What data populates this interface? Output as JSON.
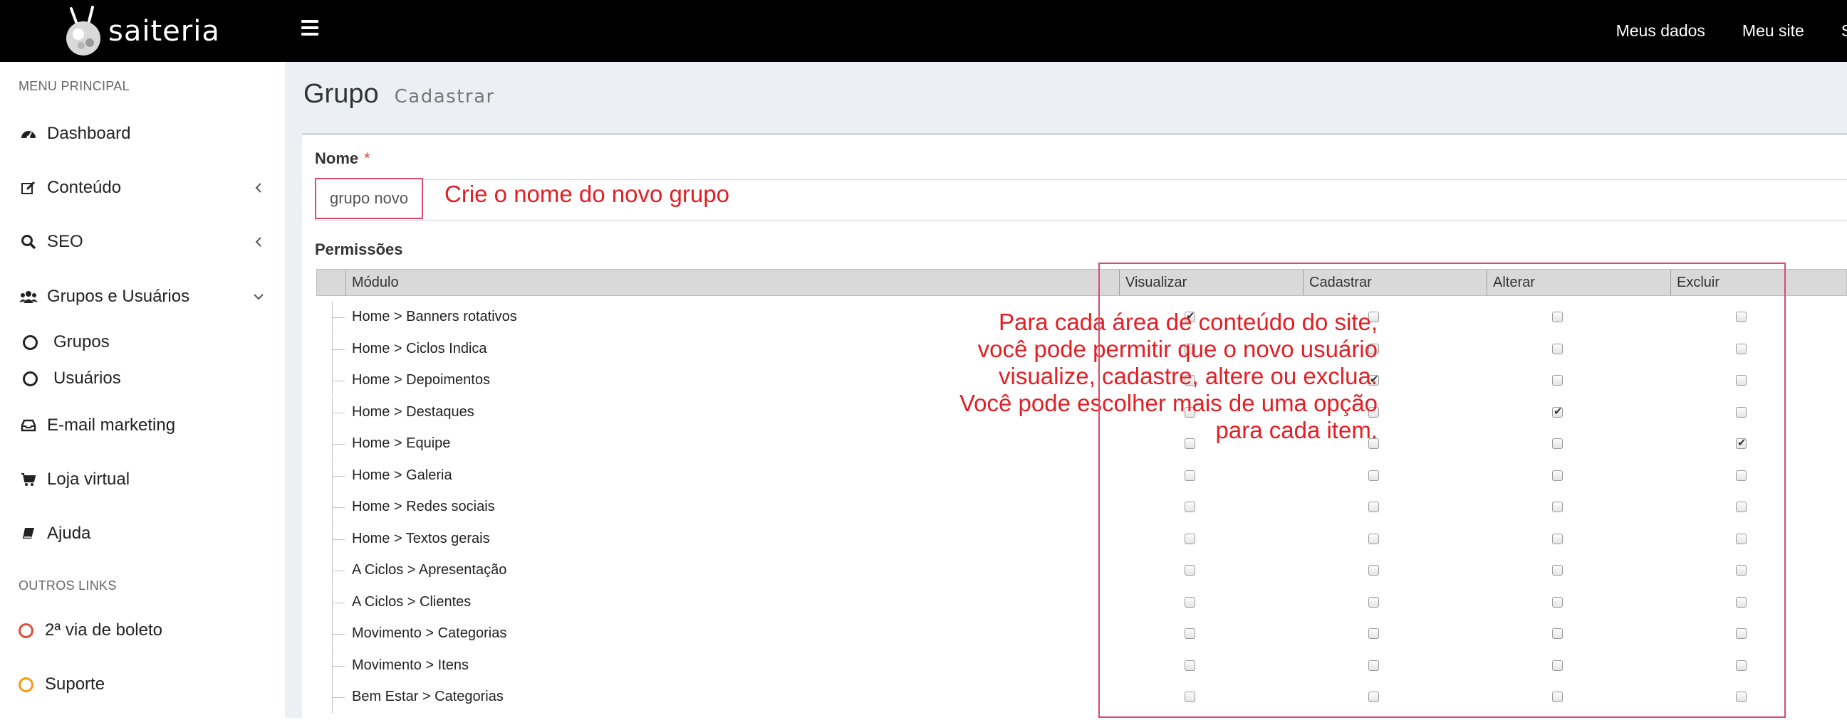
{
  "topbar": {
    "logo_text": "saiteria",
    "links": [
      "Meus dados",
      "Meu site",
      "Sa"
    ]
  },
  "sidebar": {
    "header_main": "MENU PRINCIPAL",
    "header_other": "OUTROS LINKS",
    "items": [
      {
        "label": "Dashboard",
        "icon": "dashboard-icon"
      },
      {
        "label": "Conteúdo",
        "icon": "edit-icon"
      },
      {
        "label": "SEO",
        "icon": "search-icon"
      },
      {
        "label": "Grupos e Usuários",
        "icon": "users-icon"
      },
      {
        "label": "Grupos",
        "icon": "circle-icon"
      },
      {
        "label": "Usuários",
        "icon": "circle-icon"
      },
      {
        "label": "E-mail marketing",
        "icon": "inbox-icon"
      },
      {
        "label": "Loja virtual",
        "icon": "cart-icon"
      },
      {
        "label": "Ajuda",
        "icon": "book-icon"
      },
      {
        "label": "2ª via de boleto",
        "icon": "circle-red-icon"
      },
      {
        "label": "Suporte",
        "icon": "circle-orange-icon"
      }
    ]
  },
  "page": {
    "title": "Grupo",
    "subtitle": "Cadastrar",
    "name_label": "Nome",
    "required_mark": "*",
    "name_value": "grupo novo",
    "permissions_label": "Permissões",
    "annotation_name": "Crie o nome do novo grupo",
    "annotation_perms": [
      "Para cada área de conteúdo do site,",
      "você pode permitir que o novo usuário",
      "visualize, cadastre, altere ou exclua.",
      "Você pode escolher mais de uma opção",
      "para cada item."
    ]
  },
  "table": {
    "columns": [
      "Módulo",
      "Visualizar",
      "Cadastrar",
      "Alterar",
      "Excluir"
    ],
    "rows": [
      {
        "module": "Home > Banners rotativos",
        "perms": [
          true,
          false,
          false,
          false
        ]
      },
      {
        "module": "Home > Ciclos Indica",
        "perms": [
          false,
          false,
          false,
          false
        ]
      },
      {
        "module": "Home > Depoimentos",
        "perms": [
          false,
          true,
          false,
          false
        ]
      },
      {
        "module": "Home > Destaques",
        "perms": [
          false,
          false,
          true,
          false
        ]
      },
      {
        "module": "Home > Equipe",
        "perms": [
          false,
          false,
          false,
          true
        ]
      },
      {
        "module": "Home > Galeria",
        "perms": [
          false,
          false,
          false,
          false
        ]
      },
      {
        "module": "Home > Redes sociais",
        "perms": [
          false,
          false,
          false,
          false
        ]
      },
      {
        "module": "Home > Textos gerais",
        "perms": [
          false,
          false,
          false,
          false
        ]
      },
      {
        "module": "A Ciclos > Apresentação",
        "perms": [
          false,
          false,
          false,
          false
        ]
      },
      {
        "module": "A Ciclos > Clientes",
        "perms": [
          false,
          false,
          false,
          false
        ]
      },
      {
        "module": "Movimento > Categorias",
        "perms": [
          false,
          false,
          false,
          false
        ]
      },
      {
        "module": "Movimento > Itens",
        "perms": [
          false,
          false,
          false,
          false
        ]
      },
      {
        "module": "Bem Estar > Categorias",
        "perms": [
          false,
          false,
          false,
          false
        ]
      }
    ]
  },
  "colors": {
    "topbar": "#000000",
    "content_bg": "#ecf0f5",
    "annotation": "#e31e24",
    "highlight_border": "#d94a6a"
  }
}
